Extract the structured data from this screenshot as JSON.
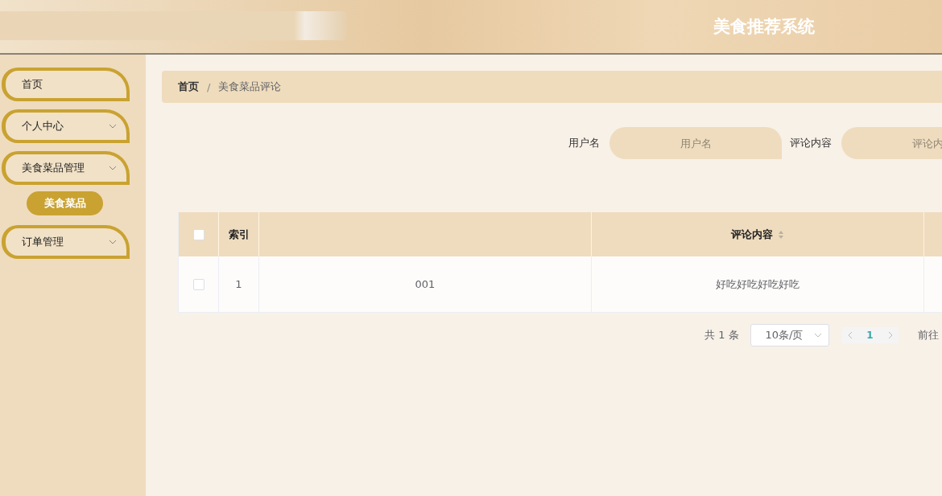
{
  "header": {
    "title": "美食推荐系统"
  },
  "sidebar": {
    "items": [
      {
        "label": "首页",
        "kind": "link"
      },
      {
        "label": "个人中心",
        "kind": "menu"
      },
      {
        "label": "美食菜品管理",
        "kind": "menu",
        "expanded": true,
        "children": [
          {
            "label": "美食菜品",
            "selected": true
          }
        ]
      },
      {
        "label": "订单管理",
        "kind": "menu"
      }
    ]
  },
  "breadcrumb": [
    "首页",
    "美食菜品评论"
  ],
  "breadcrumb_separator": "/",
  "search": [
    {
      "label": "用户名",
      "placeholder": "用户名"
    },
    {
      "label": "评论内容",
      "placeholder": "评论内"
    }
  ],
  "table": {
    "select_all_checked": false,
    "columns": [
      {
        "label": "索引",
        "sortable": false
      },
      {
        "sortable": false
      },
      {
        "label": "评论内容",
        "sortable": true
      }
    ],
    "rows": [
      {
        "checked": false,
        "cells": [
          "1",
          "001",
          "好吃好吃好吃好吃"
        ]
      }
    ]
  },
  "pagination": {
    "total": "共 1 条",
    "page_size": "10条/页",
    "pages": [
      {
        "label": "1",
        "selected": true
      }
    ],
    "goto_label": "前往"
  }
}
